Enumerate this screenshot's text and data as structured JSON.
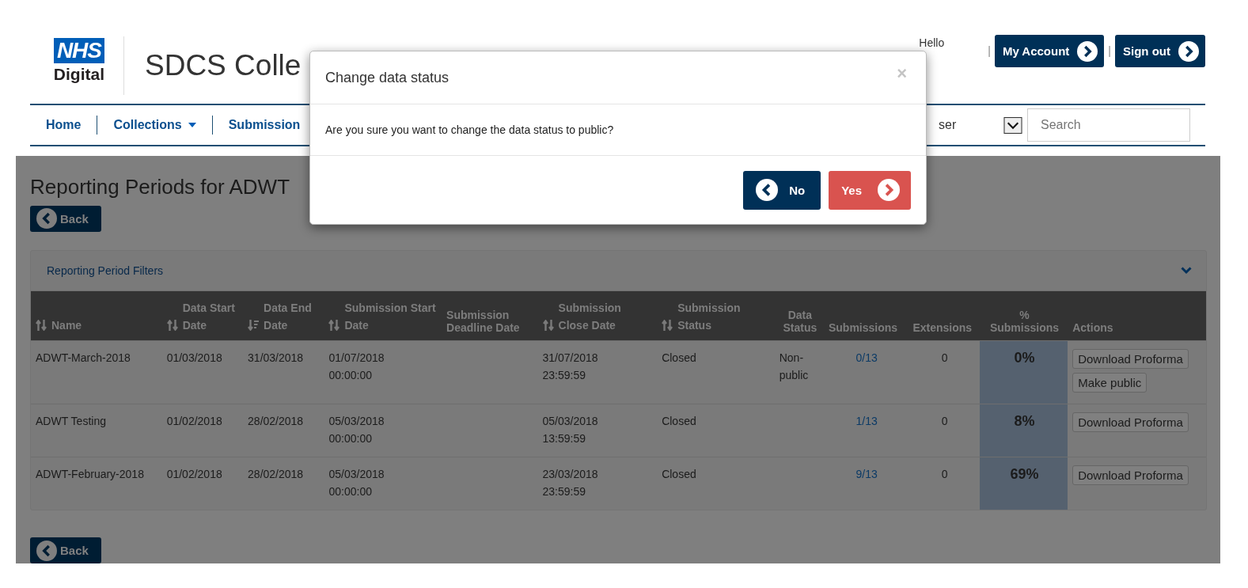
{
  "header": {
    "logo_top": "NHS",
    "logo_bottom": "Digital",
    "app_title": "SDCS Colle",
    "greeting": "Hello",
    "pipes": [
      "|",
      "|"
    ],
    "account_buttons": [
      "My Account",
      "Sign out"
    ]
  },
  "nav": {
    "items": [
      {
        "label": "Home",
        "has_caret": false
      },
      {
        "label": "Collections",
        "has_caret": true
      },
      {
        "label": "Submission",
        "has_caret": false
      }
    ],
    "role_select": "ser",
    "search": {
      "placeholder": "Search"
    }
  },
  "page": {
    "heading": "Reporting Periods for ADWT",
    "back_buttons": [
      "Back",
      "Back"
    ]
  },
  "filters": {
    "title": "Reporting Period Filters",
    "expanded": false
  },
  "table": {
    "columns": [
      {
        "label": "Name",
        "kind": "sortable"
      },
      {
        "label": "Data Start Date",
        "kind": "sortable"
      },
      {
        "label": "Data End Date",
        "kind": "sorted"
      },
      {
        "label": "Submission Start Date",
        "kind": "sortable"
      },
      {
        "label": "Submission Deadline Date",
        "kind": "plain"
      },
      {
        "label": "Submission Close Date",
        "kind": "sortable"
      },
      {
        "label": "Submission Status",
        "kind": "sortable"
      },
      {
        "label": "Data Status",
        "kind": "plain"
      },
      {
        "label": "Submissions",
        "kind": "plain"
      },
      {
        "label": "Extensions",
        "kind": "plain"
      },
      {
        "label": "% Submissions",
        "kind": "plain"
      },
      {
        "label": "Actions",
        "kind": "plain"
      }
    ],
    "rows": [
      {
        "name": "ADWT-March-2018",
        "data_start": "01/03/2018",
        "data_end": "31/03/2018",
        "sub_start": [
          "01/07/2018",
          "00:00:00"
        ],
        "deadline": "",
        "close": [
          "31/07/2018",
          "23:59:59"
        ],
        "status": "Closed",
        "data_status": [
          "Non-",
          "public"
        ],
        "submissions": "0/13",
        "extensions": "0",
        "percent": "0%",
        "actions": [
          "Download Proforma",
          "Make public"
        ]
      },
      {
        "name": "ADWT Testing",
        "data_start": "01/02/2018",
        "data_end": "28/02/2018",
        "sub_start": [
          "05/03/2018",
          "00:00:00"
        ],
        "deadline": "",
        "close": [
          "05/03/2018",
          "13:59:59"
        ],
        "status": "Closed",
        "data_status": [],
        "submissions": "1/13",
        "extensions": "0",
        "percent": "8%",
        "actions": [
          "Download Proforma"
        ]
      },
      {
        "name": "ADWT-February-2018",
        "data_start": "01/02/2018",
        "data_end": "28/02/2018",
        "sub_start": [
          "05/03/2018",
          "00:00:00"
        ],
        "deadline": "",
        "close": [
          "23/03/2018",
          "23:59:59"
        ],
        "status": "Closed",
        "data_status": [],
        "submissions": "9/13",
        "extensions": "0",
        "percent": "69%",
        "actions": [
          "Download Proforma"
        ]
      }
    ]
  },
  "modal": {
    "title": "Change data status",
    "close": "×",
    "message": "Are you sure you want to change the data status to public?",
    "buttons": [
      {
        "label": "No",
        "kind": "back"
      },
      {
        "label": "Yes",
        "kind": "confirm"
      }
    ]
  }
}
